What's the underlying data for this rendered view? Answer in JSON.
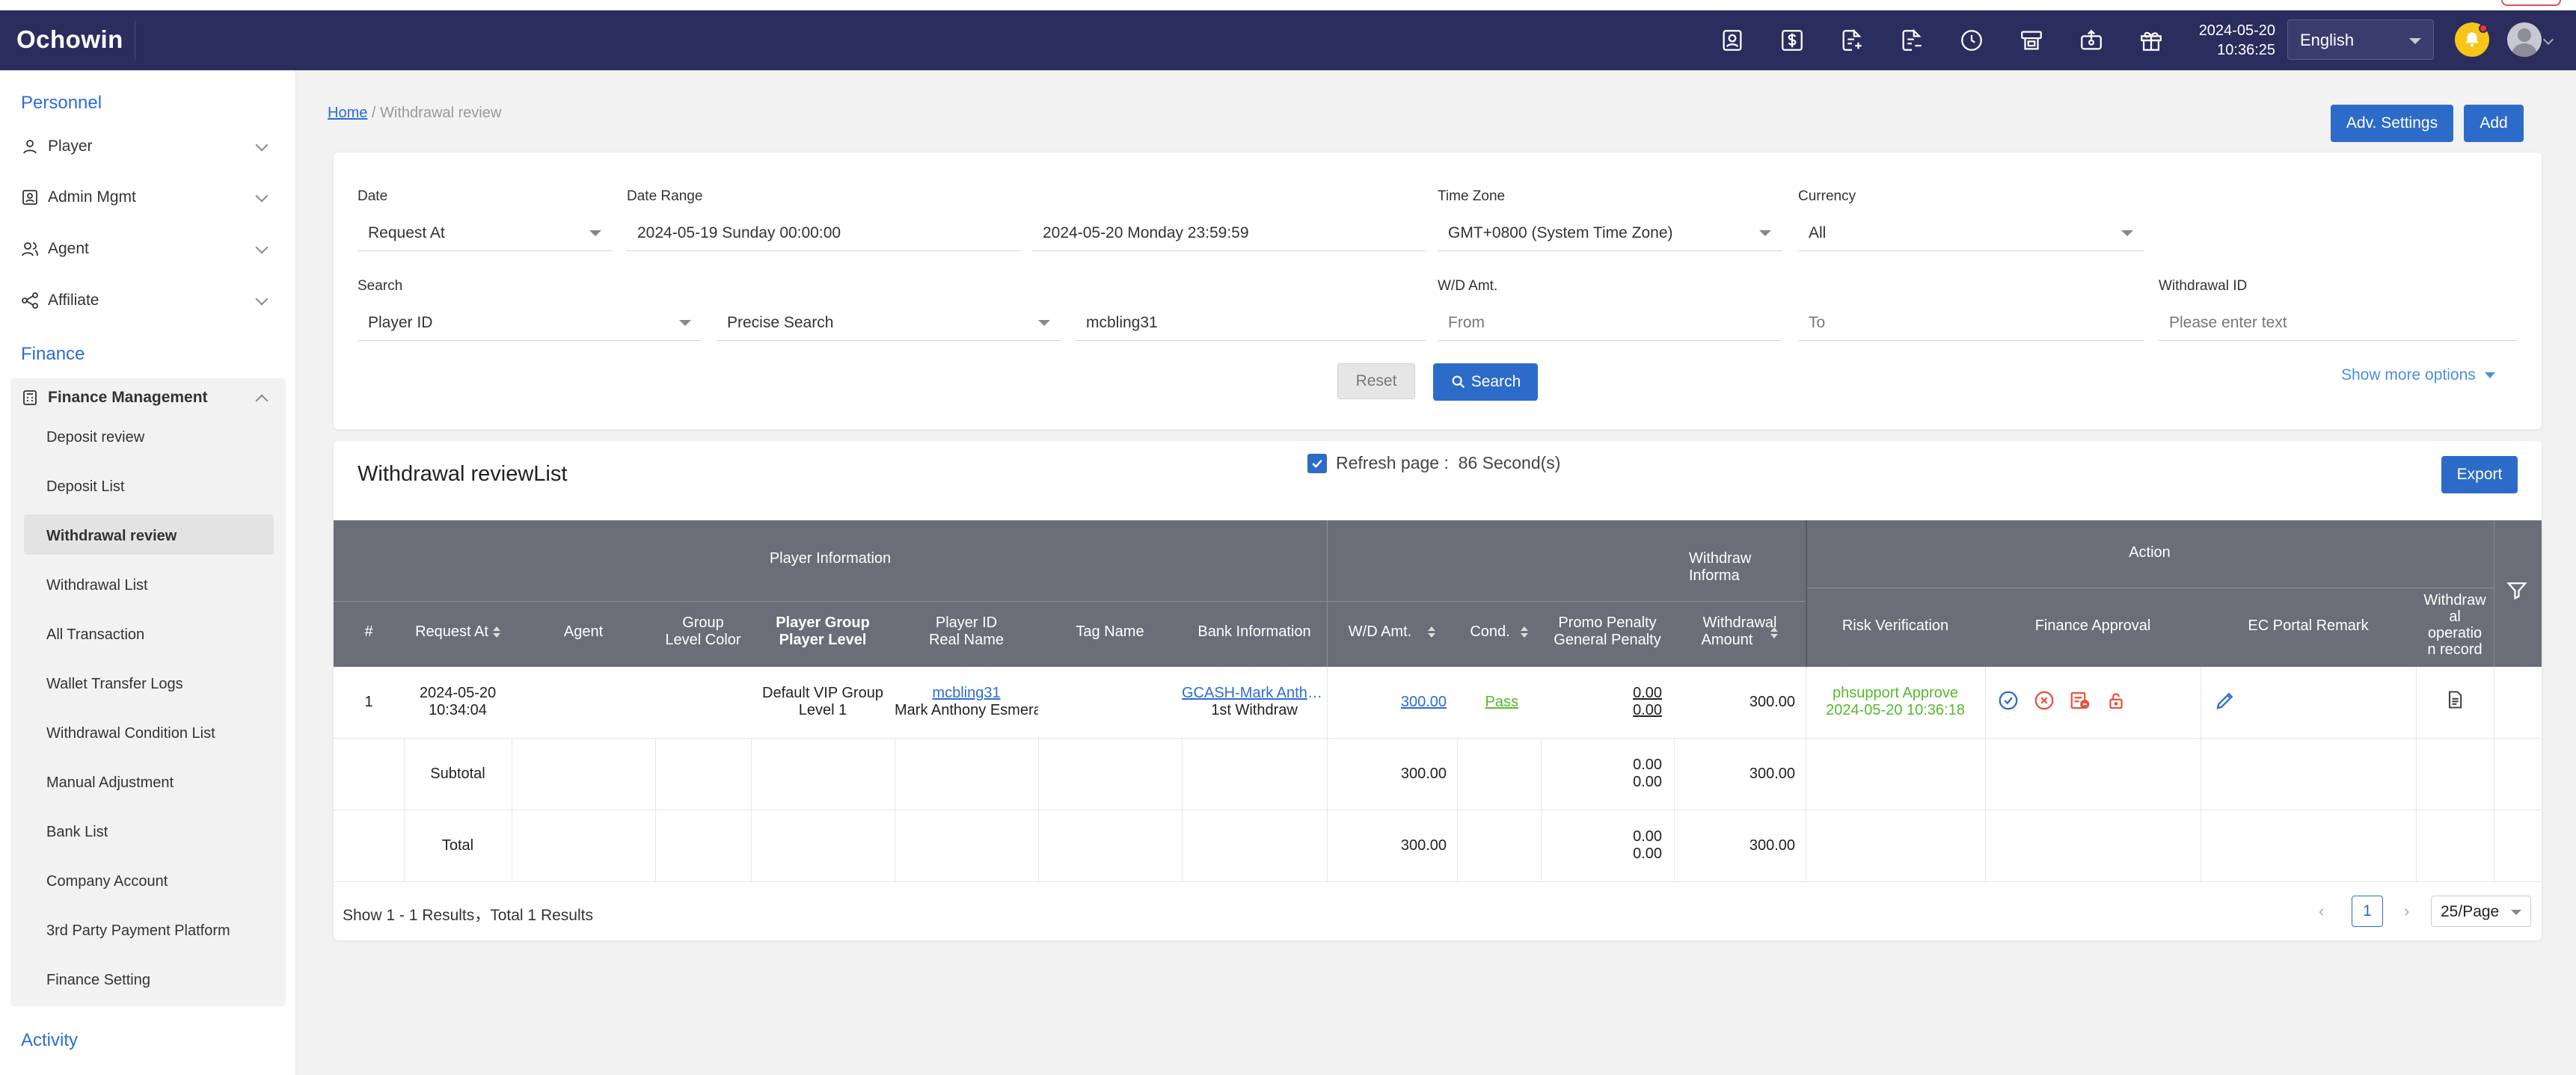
{
  "header": {
    "logo": "Ochowin",
    "date": "2024-05-20",
    "time": "10:36:25",
    "language": "English",
    "icons": [
      "member-card-icon",
      "dollar-icon",
      "report-plus-icon",
      "report-minus-icon",
      "clock-icon",
      "cashier-icon",
      "deposit-box-icon",
      "gift-icon"
    ]
  },
  "sidebar": {
    "sections": {
      "personnel": "Personnel",
      "finance": "Finance",
      "activity": "Activity"
    },
    "personnel_items": [
      {
        "label": "Player",
        "icon": "user-icon"
      },
      {
        "label": "Admin Mgmt",
        "icon": "admin-icon"
      },
      {
        "label": "Agent",
        "icon": "agent-icon"
      },
      {
        "label": "Affiliate",
        "icon": "share-icon"
      }
    ],
    "finance_group": "Finance Management",
    "finance_sub": [
      "Deposit review",
      "Deposit List",
      "Withdrawal review",
      "Withdrawal List",
      "All Transaction",
      "Wallet Transfer Logs",
      "Withdrawal Condition List",
      "Manual Adjustment",
      "Bank List",
      "Company Account",
      "3rd Party Payment Platform",
      "Finance Setting"
    ],
    "active_item": "Withdrawal review"
  },
  "breadcrumb": {
    "home": "Home",
    "sep": " / ",
    "current": "Withdrawal review"
  },
  "top_buttons": {
    "adv_settings": "Adv. Settings",
    "add": "Add"
  },
  "filters": {
    "date_label": "Date",
    "date_value": "Request At",
    "range_label": "Date Range",
    "range_start": "2024-05-19 Sunday 00:00:00",
    "range_end": "2024-05-20 Monday 23:59:59",
    "tz_label": "Time Zone",
    "tz_value": "GMT+0800 (System Time Zone)",
    "currency_label": "Currency",
    "currency_value": "All",
    "search_label": "Search",
    "search_field": "Player ID",
    "search_mode": "Precise Search",
    "search_value": "mcbling31",
    "wd_label": "W/D Amt.",
    "wd_from": "From",
    "wd_to": "To",
    "wid_label": "Withdrawal ID",
    "wid_placeholder": "Please enter text",
    "reset": "Reset",
    "search": "Search",
    "more_options": "Show more options"
  },
  "list": {
    "title": "Withdrawal reviewList",
    "refresh_label": "Refresh page :",
    "refresh_seconds": "86 Second(s)",
    "export": "Export",
    "groups": {
      "player_info": "Player Information",
      "withdraw_info": "Withdraw Informa",
      "action": "Action"
    },
    "columns": {
      "num": "#",
      "request_at": "Request At",
      "agent": "Agent",
      "group_color_1": "Group",
      "group_color_2": "Level Color",
      "player_group_1": "Player Group",
      "player_group_2": "Player Level",
      "player_id_1": "Player ID",
      "player_id_2": "Real Name",
      "tag": "Tag Name",
      "bank": "Bank Information",
      "wd_amt": "W/D Amt.",
      "cond": "Cond.",
      "promo_1": "Promo Penalty",
      "promo_2": "General Penalty",
      "withdrawal_1": "Withdrawal",
      "withdrawal_2": "Amount",
      "risk": "Risk Verification",
      "finance": "Finance Approval",
      "ec": "EC Portal Remark",
      "record_1": "Withdraw",
      "record_2": "al",
      "record_3": "operatio",
      "record_4": "n record"
    },
    "row": {
      "num": "1",
      "date": "2024-05-20",
      "time": "10:34:04",
      "group_1": "Default VIP Group",
      "group_2": "Level 1",
      "player_id": "mcbling31",
      "real_name": "Mark Anthony Esmeralda",
      "bank_1": "GCASH-Mark Anthony",
      "bank_2": "1st Withdraw",
      "wd_amt": "300.00",
      "cond": "Pass",
      "promo": "0.00",
      "general": "0.00",
      "withdrawal": "300.00",
      "risk_1": "phsupport Approve",
      "risk_2": "2024-05-20 10:36:18"
    },
    "subtotal": {
      "label": "Subtotal",
      "wd_amt": "300.00",
      "promo": "0.00",
      "general": "0.00",
      "withdrawal": "300.00"
    },
    "total": {
      "label": "Total",
      "wd_amt": "300.00",
      "promo": "0.00",
      "general": "0.00",
      "withdrawal": "300.00"
    },
    "footer": "Show 1 - 1 Results，Total 1 Results",
    "page": "1",
    "page_size": "25/Page"
  },
  "colors": {
    "header_bg": "#2b2d5f",
    "accent": "#2d6bc8",
    "table_head": "#6b6e78",
    "success": "#57b82e",
    "danger": "#e5533d"
  }
}
